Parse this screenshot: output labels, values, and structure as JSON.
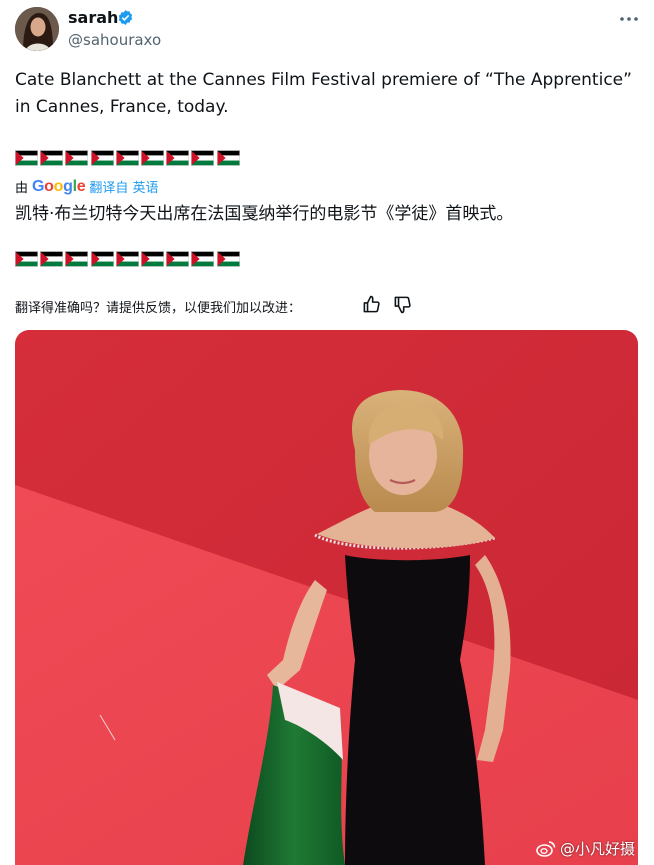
{
  "author": {
    "display_name": "sarah",
    "handle": "@sahouraxo",
    "avatar_icon": "avatar",
    "verified_icon": "verified-badge-icon"
  },
  "tweet": {
    "text": "Cate Blanchett at the Cannes Film Festival premiere of “The Apprentice” in Cannes, France, today.",
    "flag_count": 9,
    "flag_colors": {
      "black": "#000000",
      "white": "#ffffff",
      "green": "#007a3d",
      "red": "#ce1126"
    }
  },
  "translation": {
    "by_label": "由",
    "provider": "Google",
    "action_label": "翻译自 英语",
    "translated_text": "凯特·布兰切特今天出席在法国戛纳举行的电影节《学徒》首映式。",
    "feedback_prompt": "翻译得准确吗？请提供反馈，以便我们加以改进：",
    "thumbs_up_icon": "thumbs-up-icon",
    "thumbs_down_icon": "thumbs-down-icon"
  },
  "watermark": {
    "text": "@小凡好摄",
    "icon": "weibo-icon"
  },
  "colors": {
    "link_blue": "#1d9bf0",
    "secondary_text": "#536471",
    "carpet_red": "#e03440"
  }
}
